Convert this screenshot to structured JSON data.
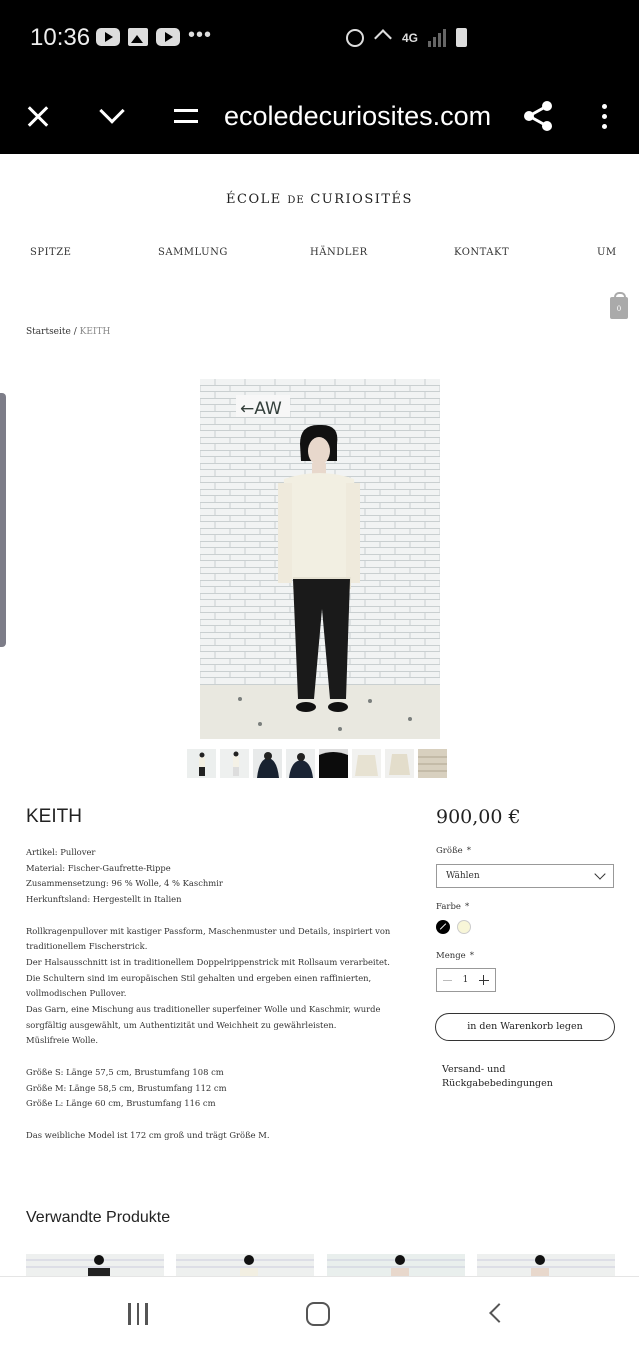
{
  "status_bar": {
    "time": "10:36",
    "network": "4G"
  },
  "browser": {
    "url": "ecoledecuriosites.com"
  },
  "site": {
    "logo_main": "ÉCOLE ",
    "logo_small": "DE",
    "logo_end": " CURIOSITÉS",
    "nav": [
      "SPITZE",
      "SAMMLUNG",
      "HÄNDLER",
      "KONTAKT",
      "UM"
    ],
    "cart_count": "0"
  },
  "breadcrumb": {
    "home": "Startseite",
    "separator": " / ",
    "current": "KEITH"
  },
  "product": {
    "title": "KEITH",
    "price": "900,00 €",
    "details": [
      "Artikel: Pullover",
      "Material: Fischer-Gaufrette-Rippe",
      "Zusammensetzung: 96 % Wolle, 4 % Kaschmir",
      "Herkunftsland: Hergestellt in Italien"
    ],
    "description": [
      "Rollkragenpullover mit kastiger Passform, Maschenmuster und Details, inspiriert von traditionellem Fischerstrick.",
      "Der Halsausschnitt ist in traditionellem Doppelrippenstrick mit Rollsaum verarbeitet. Die Schultern sind im europäischen Stil gehalten und ergeben einen raffinierten, vollmodischen Pullover.",
      "Das Garn, eine Mischung aus traditioneller superfeiner Wolle und Kaschmir, wurde sorgfältig ausgewählt, um Authentizität und Weichheit zu gewährleisten.",
      "Müslifreie Wolle."
    ],
    "sizes": [
      "Größe S: Länge 57,5 cm, Brustumfang 108 cm",
      "Größe M: Länge 58,5 cm, Brustumfang 112 cm",
      "Größe L: Länge 60 cm, Brustumfang 116 cm"
    ],
    "model_note": "Das weibliche Model ist 172 cm groß und trägt Größe M.",
    "image_sign": "←AW"
  },
  "options": {
    "size_label": "Größe",
    "required_mark": "*",
    "size_value": "Wählen",
    "color_label": "Farbe",
    "colors": [
      "#000000",
      "#f8f6d8"
    ],
    "qty_label": "Menge",
    "qty_value": "1",
    "add_to_cart": "in den Warenkorb legen",
    "shipping_link": "Versand- und Rückgabebedingungen"
  },
  "related": {
    "title": "Verwandte Produkte"
  },
  "icons": {
    "status": [
      "youtube-icon",
      "gallery-icon",
      "youtube-icon",
      "more-dots-icon",
      "alarm-icon",
      "mute-icon",
      "signal-icon",
      "battery-charging-icon"
    ],
    "browser": [
      "close-icon",
      "chevron-down-icon",
      "tune-icon",
      "share-icon",
      "kebab-menu-icon"
    ],
    "navbar": [
      "recents-icon",
      "home-icon",
      "back-icon"
    ]
  }
}
